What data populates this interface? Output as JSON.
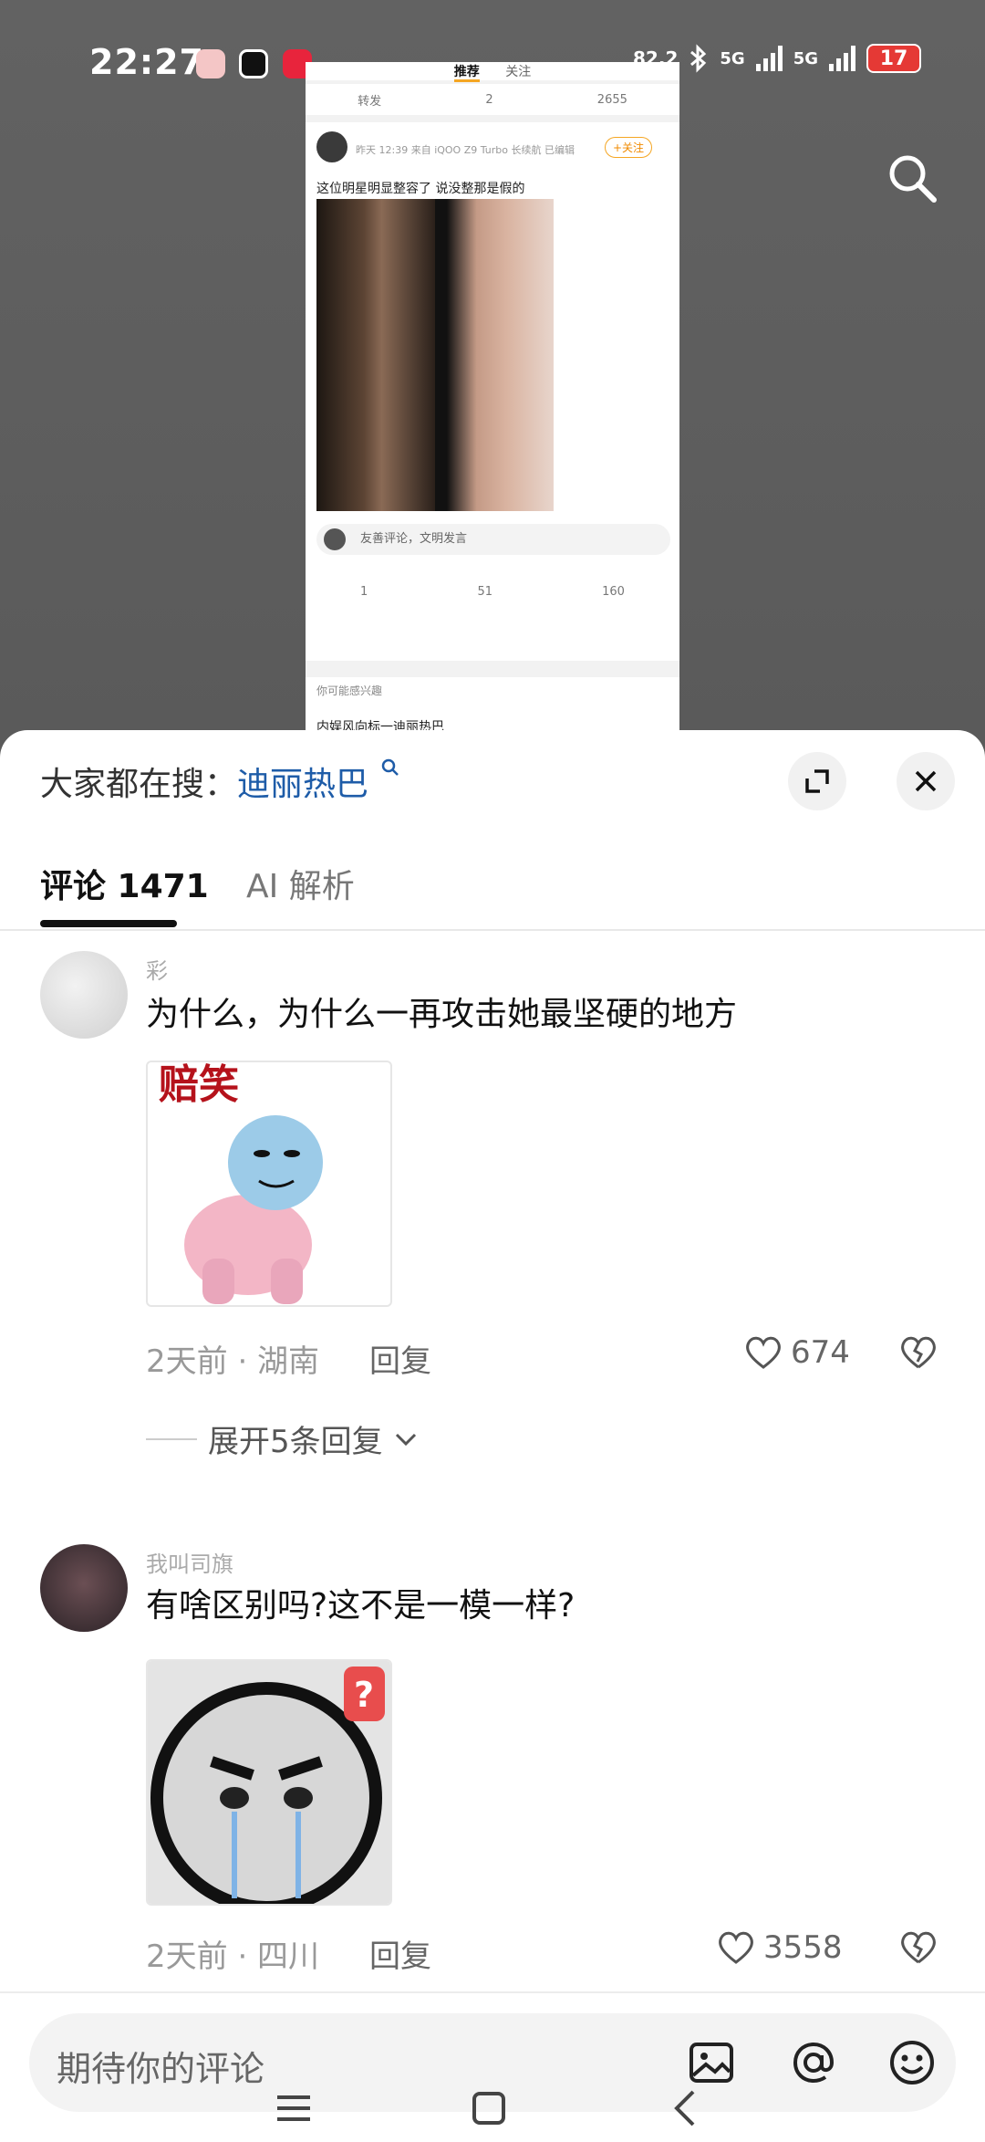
{
  "status_bar": {
    "time": "22:27",
    "net_speed": "82.2",
    "network1": "5G",
    "network2": "5G",
    "battery": "17"
  },
  "embedded_post": {
    "tabs": [
      "推荐",
      "关注"
    ],
    "top_actions": {
      "repost": "转发",
      "comments": "2",
      "likes": "2655"
    },
    "meta": "昨天 12:39  来自 iQOO Z9 Turbo 长续航  已编辑",
    "follow": "+关注",
    "text": "这位明星明显整容了 说没整那是假的",
    "comment_placeholder": "友善评论，文明发言",
    "stats": {
      "reposts": "1",
      "comments": "51",
      "likes": "160"
    },
    "recommend_title": "你可能感兴趣",
    "recommend_text": "内娱风向标一迪丽热巴"
  },
  "sheet": {
    "search_prefix": "大家都在搜：",
    "search_term": "迪丽热巴"
  },
  "tabs": {
    "comments": "评论 1471",
    "ai": "AI 解析"
  },
  "comments": [
    {
      "name": "彩",
      "text": "为什么，为什么一再攻击她最坚硬的地方",
      "sticker_caption": "赔笑",
      "time_location": "2天前 · 湖南",
      "reply": "回复",
      "likes": "674"
    },
    {
      "name": "我叫司旗",
      "text": "有啥区别吗?这不是一模一样?",
      "time_location": "2天前 · 四川",
      "reply": "回复",
      "likes": "3558"
    }
  ],
  "expand_replies": "展开5条回复",
  "input": {
    "placeholder": "期待你的评论"
  },
  "colors": {
    "accent_link": "#1e5ca8",
    "battery_low": "#e53935"
  }
}
